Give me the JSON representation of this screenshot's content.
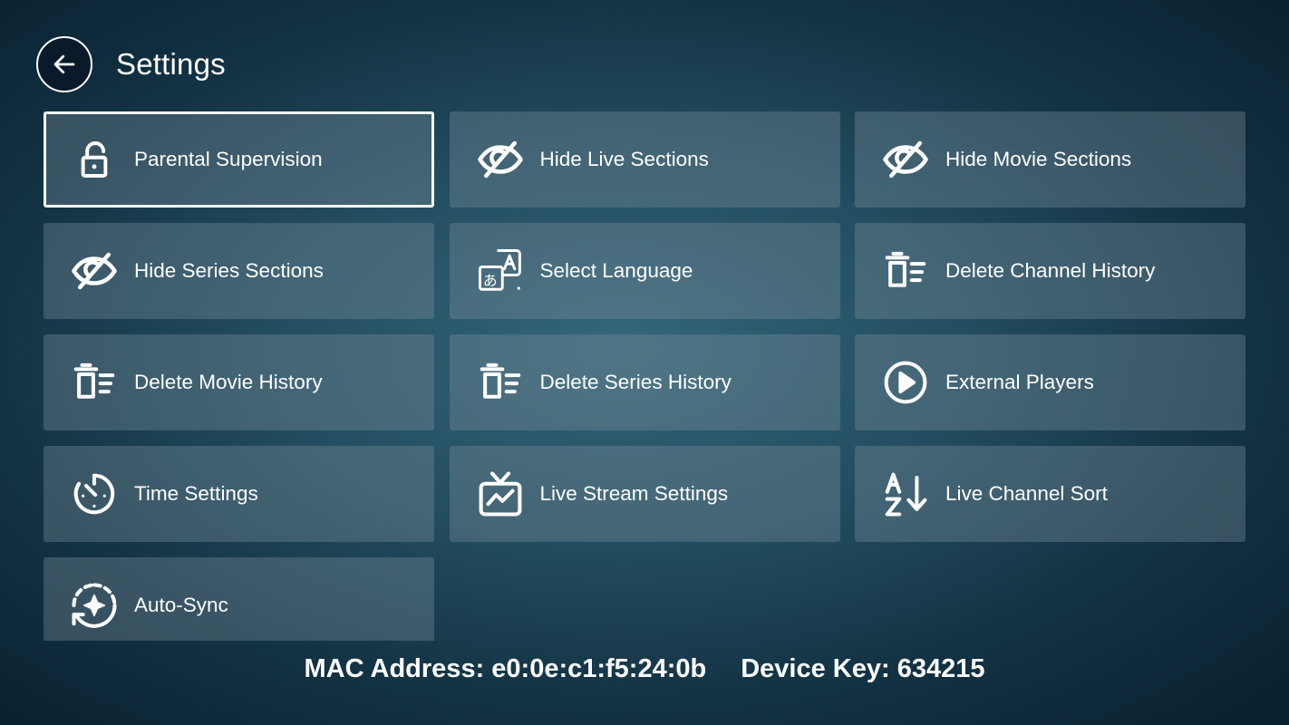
{
  "header": {
    "title": "Settings",
    "back_icon": "arrow-left-icon"
  },
  "tiles": [
    {
      "label": "Parental Supervision",
      "icon": "lock-icon",
      "focused": true
    },
    {
      "label": "Hide Live Sections",
      "icon": "eye-off-icon"
    },
    {
      "label": "Hide Movie Sections",
      "icon": "eye-off-icon"
    },
    {
      "label": "Hide Series Sections",
      "icon": "eye-off-icon"
    },
    {
      "label": "Select Language",
      "icon": "translate-icon"
    },
    {
      "label": "Delete Channel History",
      "icon": "delete-list-icon"
    },
    {
      "label": "Delete Movie History",
      "icon": "delete-list-icon"
    },
    {
      "label": "Delete Series History",
      "icon": "delete-list-icon"
    },
    {
      "label": "External Players",
      "icon": "play-circle-icon"
    },
    {
      "label": "Time Settings",
      "icon": "timer-icon"
    },
    {
      "label": "Live Stream Settings",
      "icon": "tv-icon"
    },
    {
      "label": "Live Channel Sort",
      "icon": "sort-az-icon"
    },
    {
      "label": "Auto-Sync",
      "icon": "sync-icon"
    }
  ],
  "footer": {
    "mac_address": "MAC Address: e0:0e:c1:f5:24:0b",
    "device_key": "Device Key: 634215"
  }
}
